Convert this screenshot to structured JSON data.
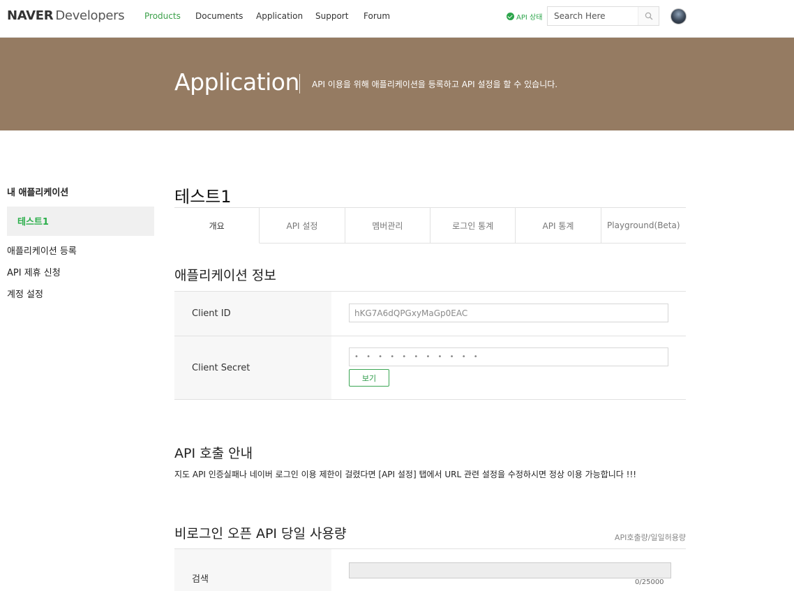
{
  "logo": {
    "brand": "NAVER",
    "product": "Developers"
  },
  "nav": {
    "items": [
      {
        "label": "Products",
        "active": true
      },
      {
        "label": "Documents",
        "active": false
      },
      {
        "label": "Application",
        "active": false
      },
      {
        "label": "Support",
        "active": false
      },
      {
        "label": "Forum",
        "active": false
      }
    ],
    "api_status": "API 상태",
    "search_placeholder": "Search Here"
  },
  "banner": {
    "title": "Application",
    "description": "API 이용을 위해 애플리케이션을 등록하고 API 설정을 할 수 있습니다."
  },
  "sidebar": {
    "title": "내 애플리케이션",
    "active_app": "테스트1",
    "links": [
      "애플리케이션 등록",
      "API 제휴 신청",
      "계정 설정"
    ]
  },
  "main": {
    "app_name": "테스트1",
    "tabs": [
      "개요",
      "API 설정",
      "멤버관리",
      "로그인 통계",
      "API 통계",
      "Playground(Beta)"
    ],
    "info": {
      "title": "애플리케이션 정보",
      "client_id_label": "Client ID",
      "client_id_value": "hKG7A6dQPGxyMaGp0EAC",
      "client_secret_label": "Client Secret",
      "client_secret_value": "• • • • • • • • • • •",
      "show_button": "보기"
    },
    "notice": {
      "title": "API 호출 안내",
      "text": "지도 API 인증실패나 네이버 로그인 이용 제한이 걸렸다면 [API 설정] 탭에서 URL 관련 설정을 수정하시면 정상 이용 가능합니다 !!!"
    },
    "usage": {
      "title": "비로그인 오픈 API 당일 사용량",
      "note": "API호출량/일일허용량",
      "row_label": "검색",
      "count": "0/25000"
    }
  },
  "colors": {
    "accent": "#3ca04a",
    "banner": "#957b62"
  }
}
